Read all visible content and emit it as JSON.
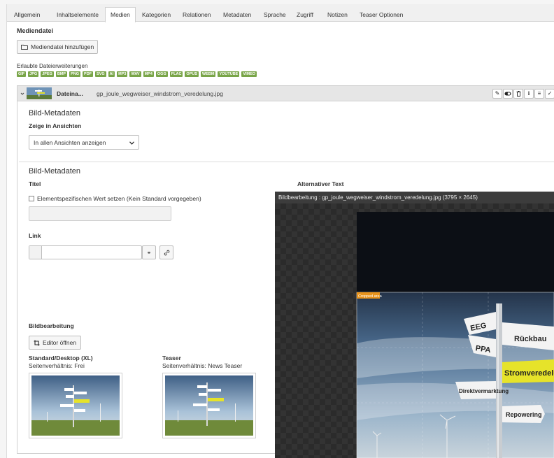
{
  "tabs": [
    "Allgemein",
    "Inhaltselemente",
    "Medien",
    "Kategorien",
    "Relationen",
    "Metadaten",
    "Sprache",
    "Zugriff",
    "Notizen",
    "Teaser Optionen"
  ],
  "active_tab": "Medien",
  "media": {
    "section_title": "Mediendatei",
    "add_button": "Mediendatei hinzufügen",
    "allowed_label": "Erlaubte Dateierweiterungen",
    "extensions": [
      "GIF",
      "JPG",
      "JPEG",
      "BMP",
      "PNG",
      "PDF",
      "SVG",
      "AI",
      "MP3",
      "WAV",
      "MP4",
      "OGG",
      "FLAC",
      "OPUS",
      "WEBM",
      "YOUTUBE",
      "VIMEO"
    ]
  },
  "file": {
    "label": "Dateina...",
    "name": "gp_joule_wegweiser_windstrom_veredelung.jpg"
  },
  "meta1": {
    "heading": "Bild-Metadaten",
    "views_label": "Zeige in Ansichten",
    "views_value": "In allen Ansichten anzeigen"
  },
  "meta2": {
    "heading": "Bild-Metadaten",
    "title_label": "Titel",
    "title_checkbox": "Elementspezifischen Wert setzen (Kein Standard vorgegeben)",
    "alt_label": "Alternativer Text",
    "link_label": "Link"
  },
  "editing": {
    "heading": "Bildbearbeitung",
    "editor_button": "Editor öffnen",
    "variants": [
      {
        "name": "Standard/Desktop (XL)",
        "ratio": "Seitenverhältnis: Frei"
      },
      {
        "name": "Teaser",
        "ratio": "Seitenverhältnis: News Teaser"
      }
    ]
  },
  "modal": {
    "title": "Bildbearbeitung : gp_joule_wegweiser_windstrom_veredelung.jpg (3795 × 2645)",
    "crop_label": "Cropped area",
    "signs": [
      "EEG",
      "Rückbau",
      "PPA",
      "Stromveredelung",
      "Direktvermarktung",
      "Repowering"
    ]
  },
  "colors": {
    "extension_badge": "#79a548",
    "crop_badge": "#e8931b",
    "highlight_sign": "#e6e32a"
  }
}
